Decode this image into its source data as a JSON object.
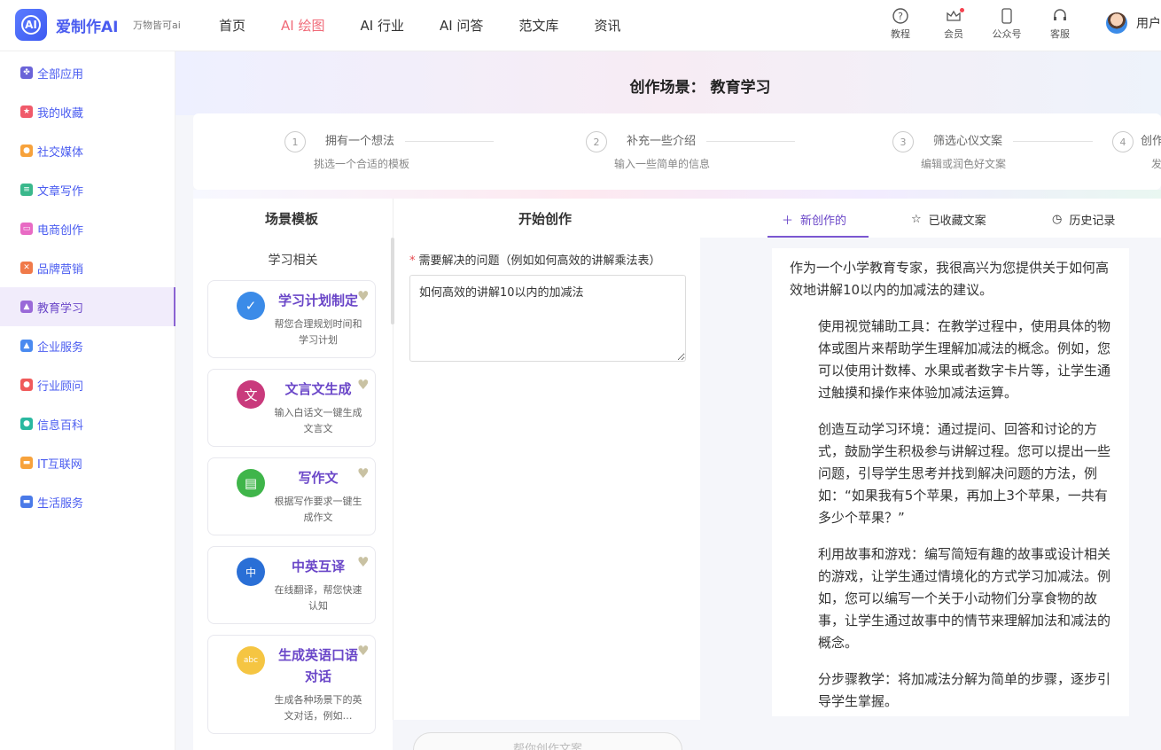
{
  "header": {
    "brand": "爱制作AI",
    "slogan": "万物皆可ai",
    "nav": [
      "首页",
      "AI 绘图",
      "AI 行业",
      "AI 问答",
      "范文库",
      "资讯"
    ],
    "tools": [
      "教程",
      "会员",
      "公众号",
      "客服"
    ],
    "user": "用户"
  },
  "sidebar": {
    "items": [
      {
        "label": "全部应用",
        "color": "#6a63d8"
      },
      {
        "label": "我的收藏",
        "color": "#f05a6a"
      },
      {
        "label": "社交媒体",
        "color": "#f7a23b"
      },
      {
        "label": "文章写作",
        "color": "#3ab88c"
      },
      {
        "label": "电商创作",
        "color": "#e86bc4"
      },
      {
        "label": "品牌营销",
        "color": "#f07a4a"
      },
      {
        "label": "教育学习",
        "color": "#9a6ad8"
      },
      {
        "label": "企业服务",
        "color": "#4a8af0"
      },
      {
        "label": "行业顾问",
        "color": "#f05a5a"
      },
      {
        "label": "信息百科",
        "color": "#2ab8a0"
      },
      {
        "label": "IT互联网",
        "color": "#f7a23b"
      },
      {
        "label": "生活服务",
        "color": "#4a7ae8"
      }
    ]
  },
  "scene": {
    "title": "创作场景：  教育学习"
  },
  "steps": [
    {
      "num": "1",
      "title": "拥有一个想法",
      "desc": "挑选一个合适的模板"
    },
    {
      "num": "2",
      "title": "补充一些介绍",
      "desc": "输入一些简单的信息"
    },
    {
      "num": "3",
      "title": "筛选心仪文案",
      "desc": "编辑或润色好文案"
    },
    {
      "num": "4",
      "title": "创作",
      "desc": "发"
    }
  ],
  "panels": {
    "templates": "场景模板",
    "create": "开始创作",
    "group": "学习相关"
  },
  "tabs": [
    "新创作的",
    "已收藏文案",
    "历史记录"
  ],
  "cards": [
    {
      "title": "学习计划制定",
      "desc": "帮您合理规划时间和学习计划",
      "color": "#3b8be8",
      "icon": "✓"
    },
    {
      "title": "文言文生成",
      "desc": "输入白话文一键生成文言文",
      "color": "#c93a7c",
      "icon": "文"
    },
    {
      "title": "写作文",
      "desc": "根据写作要求一键生成作文",
      "color": "#3fb54a",
      "icon": "▤"
    },
    {
      "title": "中英互译",
      "desc": "在线翻译，帮您快速认知",
      "color": "#2a6fd6",
      "icon": "中"
    },
    {
      "title": "生成英语口语对话",
      "desc": "生成各种场景下的英文对话，例如…",
      "color": "#f5c542",
      "icon": "abc"
    }
  ],
  "form": {
    "label": "需要解决的问题（例如如何高效的讲解乘法表）",
    "value": "如何高效的讲解10以内的加减法",
    "button": "帮你创作文案"
  },
  "result": {
    "intro": "作为一个小学教育专家，我很高兴为您提供关于如何高效地讲解10以内的加减法的建议。",
    "paragraphs": [
      "使用视觉辅助工具：在教学过程中，使用具体的物体或图片来帮助学生理解加减法的概念。例如，您可以使用计数棒、水果或者数字卡片等，让学生通过触摸和操作来体验加减法运算。",
      "创造互动学习环境：通过提问、回答和讨论的方式，鼓励学生积极参与讲解过程。您可以提出一些问题，引导学生思考并找到解决问题的方法，例如：“如果我有5个苹果，再加上3个苹果，一共有多少个苹果？”",
      "利用故事和游戏：编写简短有趣的故事或设计相关的游戏，让学生通过情境化的方式学习加减法。例如，您可以编写一个关于小动物们分享食物的故事，让学生通过故事中的情节来理解加法和减法的概念。",
      "分步骤教学：将加减法分解为简单的步骤，逐步引导学生掌握。"
    ]
  }
}
